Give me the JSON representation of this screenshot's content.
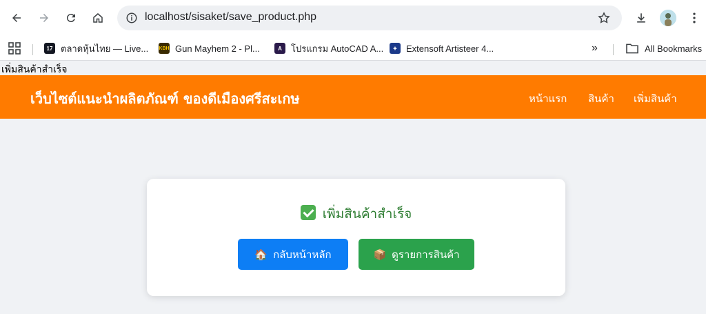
{
  "browser": {
    "url": "localhost/sisaket/save_product.php",
    "bookmarks": [
      {
        "label": "ตลาดหุ้นไทย — Live...",
        "icon": "tv-favicon"
      },
      {
        "label": "Gun Mayhem 2 - Pl...",
        "icon": "kbh-favicon"
      },
      {
        "label": "โปรแกรม AutoCAD A...",
        "icon": "autocad-favicon"
      },
      {
        "label": "Extensoft Artisteer 4...",
        "icon": "artisteer-favicon"
      }
    ],
    "overflow_label": "»",
    "all_bookmarks_label": "All Bookmarks"
  },
  "page": {
    "raw_message": "เพิ่มสินค้าสำเร็จ",
    "header": {
      "title": "เว็บไซต์แนะนำผลิตภัณฑ์ ของดีเมืองศรีสะเกษ",
      "nav": [
        "หน้าแรก",
        "สินค้า",
        "เพิ่มสินค้า"
      ],
      "color": "#ff7b00"
    },
    "card": {
      "message": "เพิ่มสินค้าสำเร็จ",
      "buttons": {
        "home": {
          "emoji": "🏠",
          "label": "กลับหน้าหลัก",
          "color": "#0d7ef5"
        },
        "list": {
          "emoji": "📦",
          "label": "ดูรายการสินค้า",
          "color": "#2ba24c"
        }
      }
    }
  }
}
